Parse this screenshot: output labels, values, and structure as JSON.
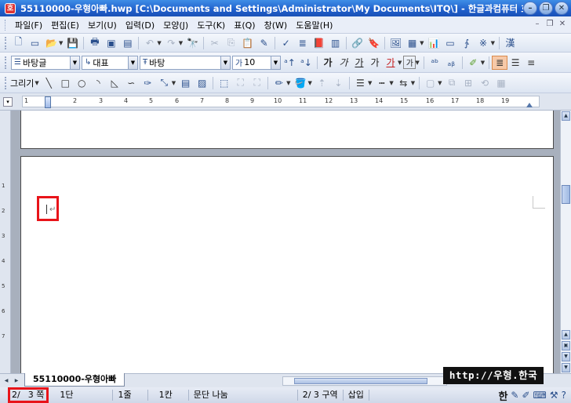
{
  "window": {
    "title": "55110000-우형아빠.hwp [C:\\Documents and Settings\\Administrator\\My Documents\\ITQ\\] - 한글과컴퓨터 호글",
    "app_icon": "hwp-app-icon",
    "controls": [
      "minimize",
      "restore",
      "close"
    ]
  },
  "menubar": {
    "items": [
      "파일(F)",
      "편집(E)",
      "보기(U)",
      "입력(D)",
      "모양(J)",
      "도구(K)",
      "표(Q)",
      "창(W)",
      "도움말(H)"
    ]
  },
  "format_toolbar": {
    "style": "바탕글",
    "lang": "대표",
    "font": "바탕",
    "size": "10",
    "size_prefix": "가",
    "bold": "가",
    "italic": "가",
    "underline": "가",
    "strike": "가",
    "color": "가",
    "highlight": "가"
  },
  "draw_toolbar": {
    "label": "그리기"
  },
  "ruler": {
    "numbers": [
      "1",
      "2",
      "3",
      "4",
      "5",
      "6",
      "7",
      "8",
      "9",
      "10",
      "11",
      "12",
      "13",
      "14",
      "15",
      "16",
      "17",
      "18",
      "19"
    ]
  },
  "vertical_ruler": {
    "numbers": [
      "1",
      "2",
      "3",
      "4",
      "5",
      "6",
      "7"
    ]
  },
  "document_tab": {
    "label": "55110000-우형아빠"
  },
  "watermark": {
    "text": "http://우형.한국"
  },
  "statusbar": {
    "page": "2/",
    "page_total": "3 쪽",
    "column": "1단",
    "line": "1줄",
    "col_char": "1칸",
    "para_break": "문단 나눔",
    "section": "2/  3 구역",
    "mode": "삽입",
    "ime": "한"
  },
  "colors": {
    "highlight_box": "#e8141a",
    "titlebar": "#1f5fcc",
    "page_background": "#a8b0bd"
  }
}
